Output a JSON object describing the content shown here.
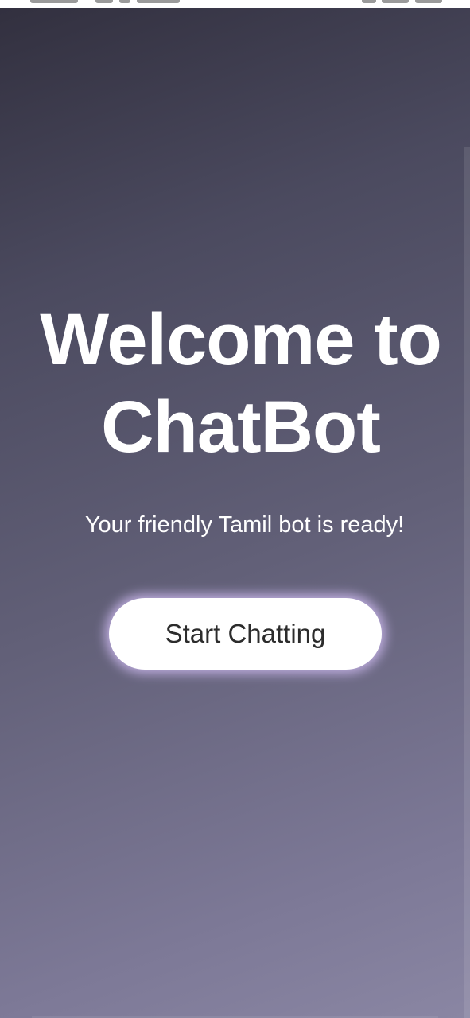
{
  "welcome": {
    "title_line1": "Welcome to",
    "title_line2": "ChatBot",
    "subtitle": "Your friendly Tamil bot is ready!",
    "start_button_label": "Start Chatting"
  },
  "colors": {
    "gradient_top": "#32303f",
    "gradient_bottom": "#8a86a3",
    "button_background": "#ffffff",
    "button_glow": "#cebaf0",
    "text": "#ffffff"
  }
}
